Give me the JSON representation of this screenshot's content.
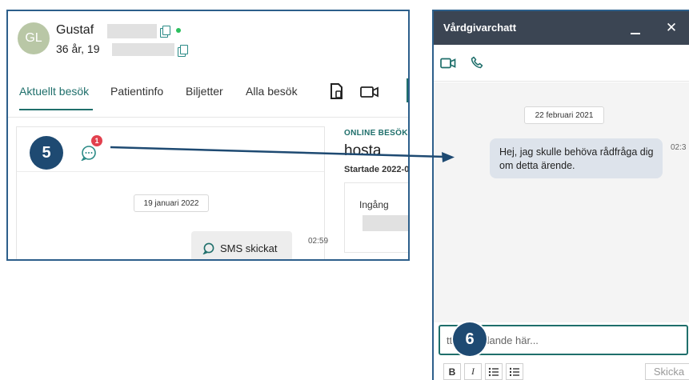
{
  "patient": {
    "initials": "GL",
    "name": "Gustaf",
    "age_line": "36 år, 19"
  },
  "tabs": [
    {
      "label": "Aktuellt besök"
    },
    {
      "label": "Patientinfo"
    },
    {
      "label": "Biljetter"
    },
    {
      "label": "Alla besök"
    }
  ],
  "left_chat": {
    "badge_count": "1",
    "date": "19 januari 2022",
    "sms_label": "SMS skickat",
    "time": "02:59"
  },
  "visit": {
    "label": "ONLINE BESÖK",
    "title": "hosta",
    "started": "Startade 2022-0",
    "entry_label": "Ingång"
  },
  "chat_panel": {
    "title": "Vårdgivarchatt",
    "date": "22 februari 2021",
    "message": "Hej, jag skulle behöva rådfråga dig om detta ärende.",
    "time": "02:3",
    "placeholder": "tt meddelande här...",
    "bold_label": "B",
    "italic_label": "I",
    "send_label": "Skicka"
  },
  "annotations": {
    "step_a": "5",
    "step_b": "6"
  },
  "colors": {
    "accent_teal": "#1f6f6b",
    "header_dark": "#3b4553",
    "annotation_blue": "#1e4a72",
    "badge_red": "#e2404e",
    "frame_blue": "#2d5f8b"
  }
}
